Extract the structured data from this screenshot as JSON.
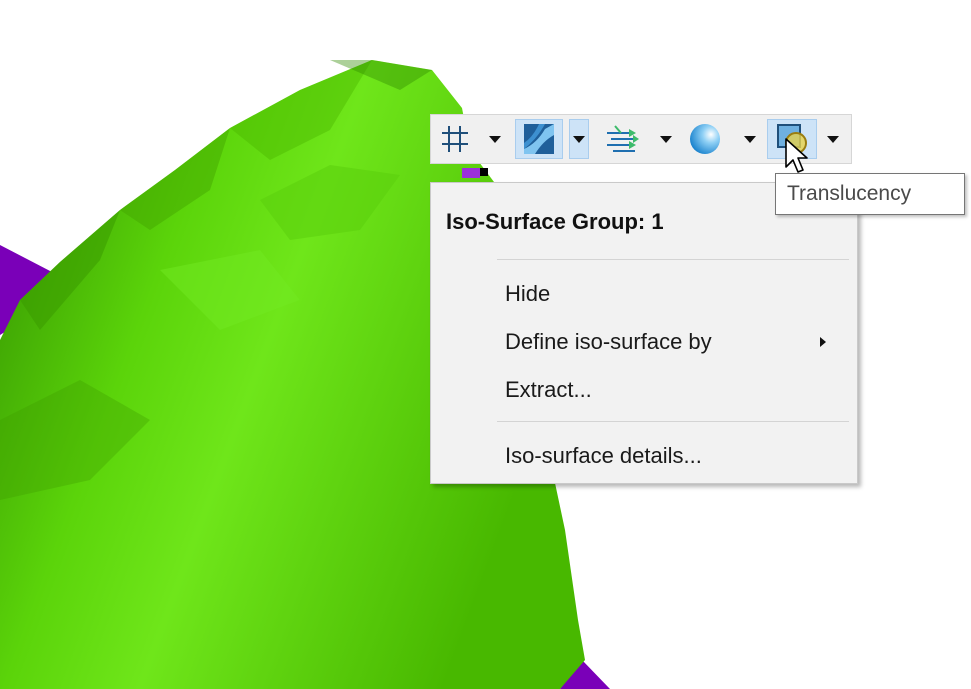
{
  "toolbar": {
    "buttons": [
      {
        "icon": "grid-icon",
        "active": false
      },
      {
        "icon": "surface-shading-icon",
        "active": true
      },
      {
        "icon": "flow-arrows-icon",
        "active": false
      },
      {
        "icon": "sphere-icon",
        "active": false
      },
      {
        "icon": "translucency-icon",
        "active": true
      }
    ]
  },
  "context_menu": {
    "header": "Iso-Surface Group: 1",
    "items": [
      {
        "label": "Hide",
        "has_submenu": false
      },
      {
        "label": "Define iso-surface by",
        "has_submenu": true
      },
      {
        "label": "Extract...",
        "has_submenu": false
      },
      {
        "label": "Iso-surface details...",
        "has_submenu": false
      }
    ]
  },
  "tooltip": {
    "text": "Translucency"
  },
  "colors": {
    "surface_green": "#52c800",
    "surface_highlight": "#6fe61a",
    "surface_shadow": "#3a9400",
    "surface_purple": "#7a00b8",
    "toolbar_active": "#cde3f7",
    "menu_background": "#f2f2f2"
  }
}
